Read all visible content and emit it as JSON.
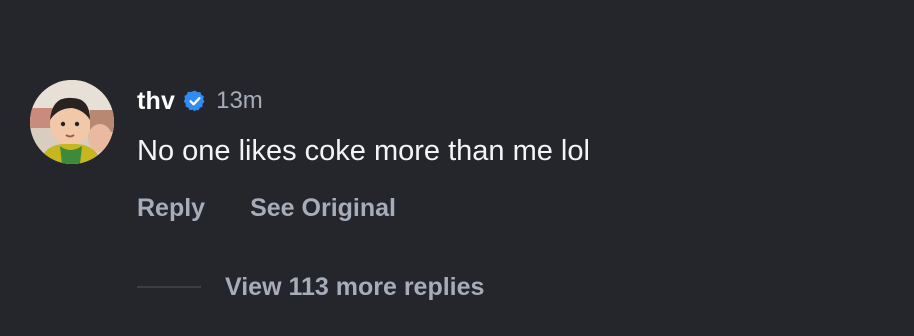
{
  "comment": {
    "username": "thv",
    "verified_icon": "verified-badge-icon",
    "timestamp": "13m",
    "text": "No one likes coke more than me lol",
    "actions": {
      "reply_label": "Reply",
      "see_original_label": "See Original"
    },
    "replies": {
      "view_more_label": "View 113 more replies"
    }
  },
  "colors": {
    "background": "#24262b",
    "primary_text": "#ffffff",
    "secondary_text": "#a6acb8",
    "verified_badge": "#2f8cf5"
  }
}
